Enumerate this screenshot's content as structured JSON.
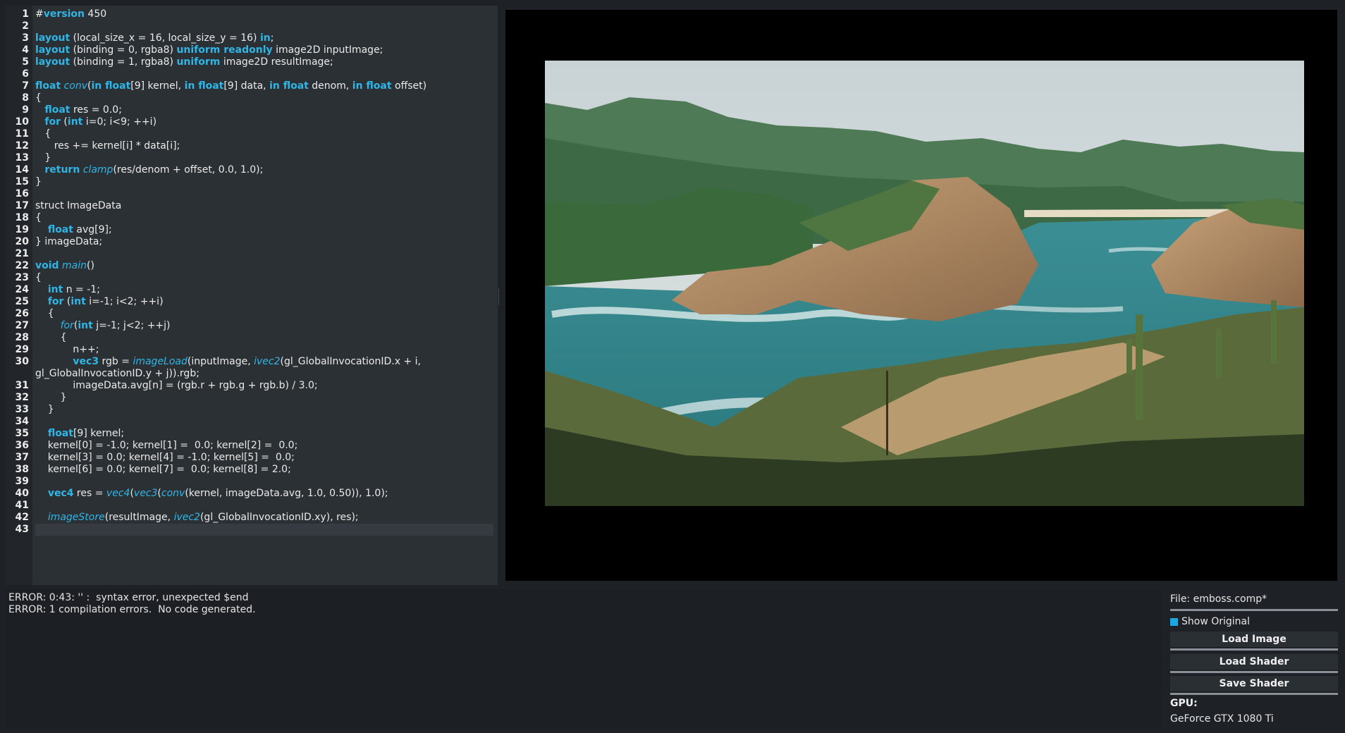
{
  "editor": {
    "lines": [
      {
        "n": "1",
        "segs": [
          [
            "#",
            ""
          ],
          [
            "version",
            "kw"
          ],
          [
            " 450",
            ""
          ]
        ]
      },
      {
        "n": "2",
        "segs": []
      },
      {
        "n": "3",
        "segs": [
          [
            "layout",
            "kw"
          ],
          [
            " (local_size_x = 16, local_size_y = 16) ",
            ""
          ],
          [
            "in",
            "kw"
          ],
          [
            ";",
            ""
          ]
        ]
      },
      {
        "n": "4",
        "segs": [
          [
            "layout",
            "kw"
          ],
          [
            " (binding = 0, rgba8) ",
            ""
          ],
          [
            "uniform readonly",
            "kw"
          ],
          [
            " image2D inputImage;",
            ""
          ]
        ]
      },
      {
        "n": "5",
        "segs": [
          [
            "layout",
            "kw"
          ],
          [
            " (binding = 1, rgba8) ",
            ""
          ],
          [
            "uniform",
            "kw"
          ],
          [
            " image2D resultImage;",
            ""
          ]
        ]
      },
      {
        "n": "6",
        "segs": []
      },
      {
        "n": "7",
        "segs": [
          [
            "float",
            "kw"
          ],
          [
            " ",
            ""
          ],
          [
            "conv",
            "fn"
          ],
          [
            "(",
            ""
          ],
          [
            "in float",
            "kw"
          ],
          [
            "[9] kernel, ",
            ""
          ],
          [
            "in float",
            "kw"
          ],
          [
            "[9] data, ",
            ""
          ],
          [
            "in float",
            "kw"
          ],
          [
            " denom, ",
            ""
          ],
          [
            "in float",
            "kw"
          ],
          [
            " offset)",
            ""
          ]
        ]
      },
      {
        "n": "8",
        "segs": [
          [
            "{",
            ""
          ]
        ]
      },
      {
        "n": "9",
        "segs": [
          [
            "   ",
            ""
          ],
          [
            "float",
            "kw"
          ],
          [
            " res = 0.0;",
            ""
          ]
        ]
      },
      {
        "n": "10",
        "segs": [
          [
            "   ",
            ""
          ],
          [
            "for",
            "kw"
          ],
          [
            " (",
            ""
          ],
          [
            "int",
            "kw"
          ],
          [
            " i=0; i<9; ++i)",
            ""
          ]
        ]
      },
      {
        "n": "11",
        "segs": [
          [
            "   {",
            ""
          ]
        ]
      },
      {
        "n": "12",
        "segs": [
          [
            "      res += kernel[i] * data[i];",
            ""
          ]
        ]
      },
      {
        "n": "13",
        "segs": [
          [
            "   }",
            ""
          ]
        ]
      },
      {
        "n": "14",
        "segs": [
          [
            "   ",
            ""
          ],
          [
            "return",
            "kw"
          ],
          [
            " ",
            ""
          ],
          [
            "clamp",
            "fn"
          ],
          [
            "(res/denom + offset, 0.0, 1.0);",
            ""
          ]
        ]
      },
      {
        "n": "15",
        "segs": [
          [
            "}",
            ""
          ]
        ]
      },
      {
        "n": "16",
        "segs": []
      },
      {
        "n": "17",
        "segs": [
          [
            "struct ImageData",
            ""
          ]
        ]
      },
      {
        "n": "18",
        "segs": [
          [
            "{",
            ""
          ]
        ]
      },
      {
        "n": "19",
        "segs": [
          [
            "    ",
            ""
          ],
          [
            "float",
            "kw"
          ],
          [
            " avg[9];",
            ""
          ]
        ]
      },
      {
        "n": "20",
        "segs": [
          [
            "} imageData;",
            ""
          ]
        ]
      },
      {
        "n": "21",
        "segs": []
      },
      {
        "n": "22",
        "segs": [
          [
            "void",
            "kw"
          ],
          [
            " ",
            ""
          ],
          [
            "main",
            "fn"
          ],
          [
            "()",
            ""
          ]
        ]
      },
      {
        "n": "23",
        "segs": [
          [
            "{",
            ""
          ]
        ]
      },
      {
        "n": "24",
        "segs": [
          [
            "    ",
            ""
          ],
          [
            "int",
            "kw"
          ],
          [
            " n = -1;",
            ""
          ]
        ]
      },
      {
        "n": "25",
        "segs": [
          [
            "    ",
            ""
          ],
          [
            "for",
            "kw"
          ],
          [
            " (",
            ""
          ],
          [
            "int",
            "kw"
          ],
          [
            " i=-1; i<2; ++i)",
            ""
          ]
        ]
      },
      {
        "n": "26",
        "segs": [
          [
            "    {",
            ""
          ]
        ]
      },
      {
        "n": "27",
        "segs": [
          [
            "        ",
            ""
          ],
          [
            "for",
            "fn"
          ],
          [
            "(",
            ""
          ],
          [
            "int",
            "kw"
          ],
          [
            " j=-1; j<2; ++j)",
            ""
          ]
        ]
      },
      {
        "n": "28",
        "segs": [
          [
            "        {",
            ""
          ]
        ]
      },
      {
        "n": "29",
        "segs": [
          [
            "            n++;",
            ""
          ]
        ]
      },
      {
        "n": "30",
        "segs": [
          [
            "            ",
            ""
          ],
          [
            "vec3",
            "kw"
          ],
          [
            " rgb = ",
            ""
          ],
          [
            "imageLoad",
            "fn"
          ],
          [
            "(inputImage, ",
            ""
          ],
          [
            "ivec2",
            "fn"
          ],
          [
            "(gl_GlobalInvocationID.x + i,",
            ""
          ]
        ]
      },
      {
        "n": "",
        "segs": [
          [
            "gl_GlobalInvocationID.y + j)).rgb;",
            ""
          ]
        ]
      },
      {
        "n": "31",
        "segs": [
          [
            "            imageData.avg[n] = (rgb.r + rgb.g + rgb.b) / 3.0;",
            ""
          ]
        ]
      },
      {
        "n": "32",
        "segs": [
          [
            "        }",
            ""
          ]
        ]
      },
      {
        "n": "33",
        "segs": [
          [
            "    }",
            ""
          ]
        ]
      },
      {
        "n": "34",
        "segs": []
      },
      {
        "n": "35",
        "segs": [
          [
            "    ",
            ""
          ],
          [
            "float",
            "kw"
          ],
          [
            "[9] kernel;",
            ""
          ]
        ]
      },
      {
        "n": "36",
        "segs": [
          [
            "    kernel[0] = -1.0; kernel[1] =  0.0; kernel[2] =  0.0;",
            ""
          ]
        ]
      },
      {
        "n": "37",
        "segs": [
          [
            "    kernel[3] = 0.0; kernel[4] = -1.0; kernel[5] =  0.0;",
            ""
          ]
        ]
      },
      {
        "n": "38",
        "segs": [
          [
            "    kernel[6] = 0.0; kernel[7] =  0.0; kernel[8] = 2.0;",
            ""
          ]
        ]
      },
      {
        "n": "39",
        "segs": []
      },
      {
        "n": "40",
        "segs": [
          [
            "    ",
            ""
          ],
          [
            "vec4",
            "kw"
          ],
          [
            " res = ",
            ""
          ],
          [
            "vec4",
            "fn"
          ],
          [
            "(",
            ""
          ],
          [
            "vec3",
            "fn"
          ],
          [
            "(",
            ""
          ],
          [
            "conv",
            "fn"
          ],
          [
            "(kernel, imageData.avg, 1.0, 0.50)), 1.0);",
            ""
          ]
        ]
      },
      {
        "n": "41",
        "segs": []
      },
      {
        "n": "42",
        "segs": [
          [
            "    ",
            ""
          ],
          [
            "imageStore",
            "fn"
          ],
          [
            "(resultImage, ",
            ""
          ],
          [
            "ivec2",
            "fn"
          ],
          [
            "(gl_GlobalInvocationID.xy), res);",
            ""
          ]
        ]
      },
      {
        "n": "43",
        "segs": [],
        "current": true
      }
    ]
  },
  "console": {
    "errors": [
      "ERROR: 0:43: '' :  syntax error, unexpected $end",
      "ERROR: 1 compilation errors.  No code generated."
    ]
  },
  "panel": {
    "file_label": "File: emboss.comp*",
    "show_original_label": "Show Original",
    "show_original_checked": true,
    "load_image_label": "Load Image",
    "load_shader_label": "Load Shader",
    "save_shader_label": "Save Shader",
    "gpu_label": "GPU:",
    "gpu_name": "GeForce GTX 1080 Ti"
  },
  "viewport": {
    "image_alt": "Coastal landscape with rocky cove and turquoise water"
  },
  "colors": {
    "keyword": "#2fb6e6",
    "accent": "#1ea7df",
    "editor_bg": "#2b3035",
    "viewport_bg": "#000000"
  }
}
